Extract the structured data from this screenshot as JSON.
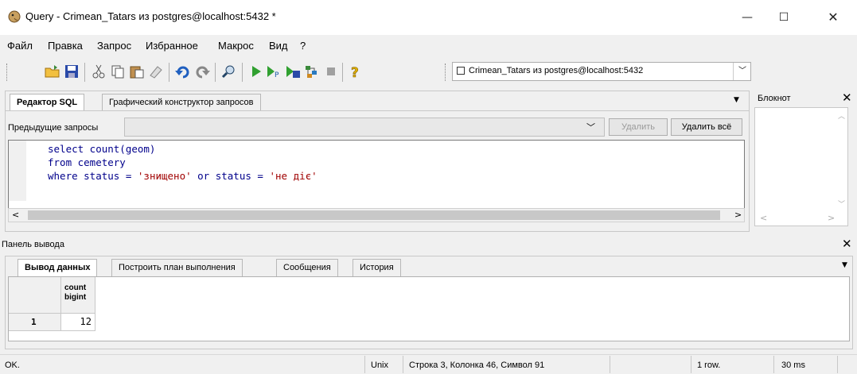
{
  "window": {
    "title": "Query - Crimean_Tatars из postgres@localhost:5432 *",
    "minimize_glyph": "—",
    "maximize_glyph": "☐",
    "close_glyph": "✕"
  },
  "menu": {
    "items": [
      "Файл",
      "Правка",
      "Запрос",
      "Избранное",
      "Макрос",
      "Вид",
      "?"
    ]
  },
  "toolbar": {
    "icons": [
      "open-icon",
      "save-icon",
      "cut-icon",
      "copy-icon",
      "paste-icon",
      "clear-icon",
      "undo-icon",
      "redo-icon",
      "find-icon",
      "execute-icon",
      "explain-icon",
      "execute-file-icon",
      "explain-analyze-icon",
      "stop-icon",
      "help-icon"
    ],
    "connection": "Crimean_Tatars из postgres@localhost:5432"
  },
  "sql_panel": {
    "tabs": [
      "Редактор SQL",
      "Графический конструктор запросов"
    ],
    "previous_queries_label": "Предыдущие запросы",
    "delete_label": "Удалить",
    "delete_all_label": "Удалить всё",
    "code": {
      "line1": "select count(geom)",
      "line2": "from cemetery",
      "line3_prefix": "where status = ",
      "line3_str1": "'знищено'",
      "line3_mid": " or status = ",
      "line3_str2": "'не діє'"
    }
  },
  "notepad": {
    "title": "Блокнот"
  },
  "output_panel": {
    "title": "Панель вывода",
    "tabs": [
      "Вывод данных",
      "Построить план выполнения",
      "Сообщения",
      "История"
    ],
    "grid": {
      "column_name": "count",
      "column_type": "bigint",
      "rows": [
        {
          "num": "1",
          "value": "12"
        }
      ]
    }
  },
  "status_bar": {
    "message": "OK.",
    "line_ending": "Unix",
    "position": "Строка 3, Колонка 46, Символ 91",
    "rows": "1 row.",
    "time": "30 ms"
  }
}
